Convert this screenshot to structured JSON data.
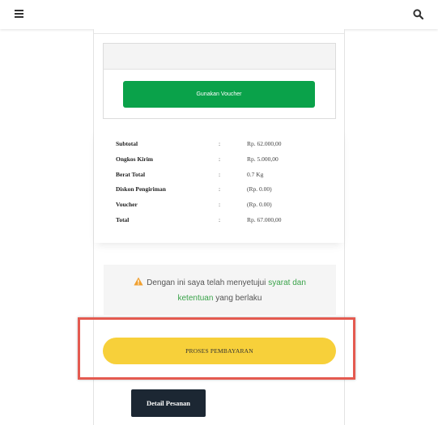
{
  "header": {
    "menu_icon": "hamburger-menu-icon",
    "search_icon": "search-icon"
  },
  "voucher": {
    "button_label": "Gunakan Voucher"
  },
  "summary": {
    "rows": [
      {
        "label": "Subtotal",
        "colon": ":",
        "value": "Rp. 62.000,00"
      },
      {
        "label": "Ongkos Kirim",
        "colon": ":",
        "value": "Rp. 5.000,00"
      },
      {
        "label": "Berat Total",
        "colon": ":",
        "value": "0.7 Kg"
      },
      {
        "label": "Diskon Pengiriman",
        "colon": ":",
        "value": "(Rp. 0.00)"
      },
      {
        "label": "Voucher",
        "colon": ":",
        "value": "(Rp. 0.00)"
      },
      {
        "label": "Total",
        "colon": ":",
        "value": "Rp. 67.000,00"
      }
    ]
  },
  "agreement": {
    "icon": "warning-icon",
    "text_before": "Dengan ini saya telah menyetujui ",
    "link_part1": "syarat dan",
    "link_part2": "ketentuan",
    "text_after": " yang berlaku"
  },
  "actions": {
    "pay_label": "PROSES PEMBAYARAN",
    "detail_label": "Detail Pesanan"
  },
  "colors": {
    "voucher_button": "#0aa24a",
    "pay_button": "#f7d03a",
    "detail_button": "#1c2733",
    "highlight_border": "#e45a50",
    "link": "#3aa34a"
  }
}
